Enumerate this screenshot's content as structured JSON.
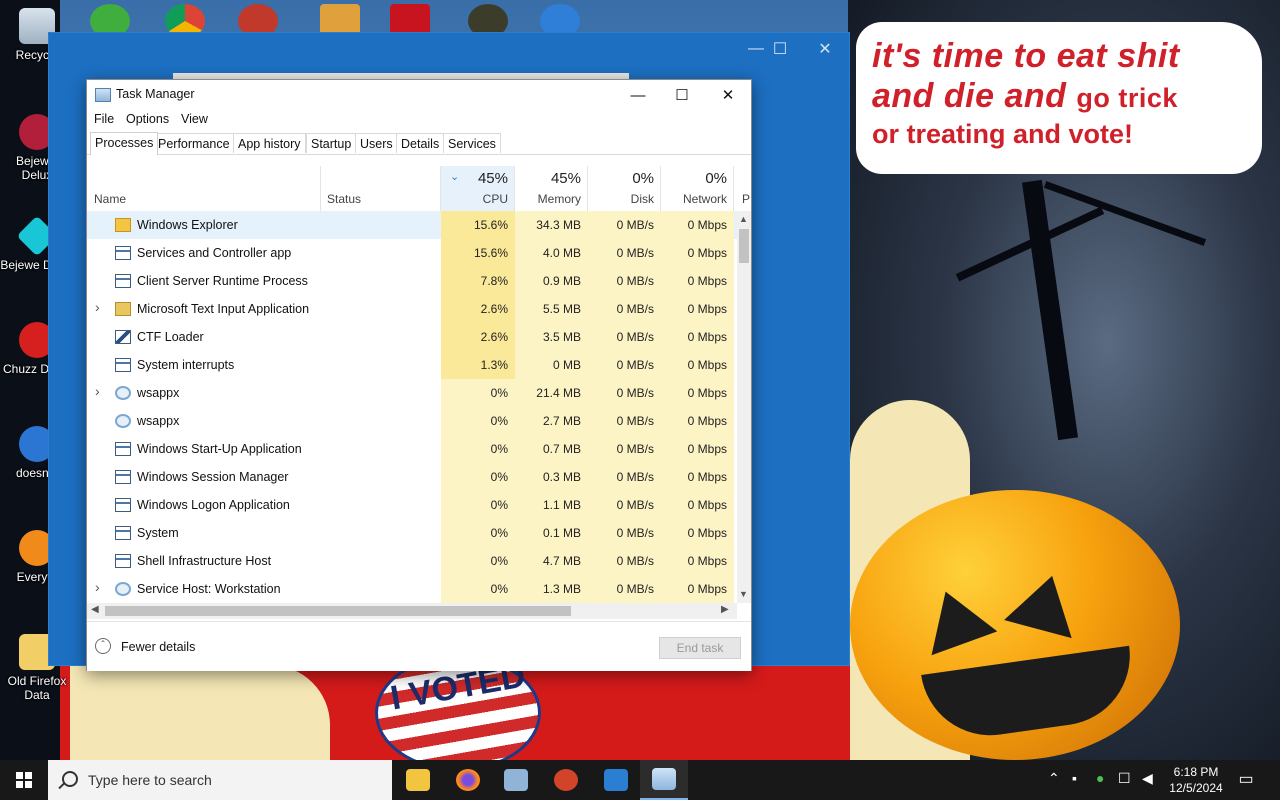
{
  "desktop": {
    "speech_bubble": {
      "line1": "it's time to eat shit",
      "line2a": "and die and",
      "line2b": "go trick",
      "line3": "or treating and vote!"
    },
    "badge_text": "I VOTED",
    "icons": [
      {
        "name": "recycle-bin",
        "label": "Recycle"
      },
      {
        "name": "bejeweled-1",
        "label": "Bejewel Delux"
      },
      {
        "name": "bejeweled-2",
        "label": "Bejewe Delux"
      },
      {
        "name": "chuzzle",
        "label": "Chuzz Delux"
      },
      {
        "name": "doesnt",
        "label": "doesnt l"
      },
      {
        "name": "everything",
        "label": "Everyth"
      },
      {
        "name": "old-firefox-data",
        "label": "Old Firefox Data"
      }
    ]
  },
  "task_manager": {
    "title": "Task Manager",
    "menu": [
      "File",
      "Options",
      "View"
    ],
    "tabs": [
      "Processes",
      "Performance",
      "App history",
      "Startup",
      "Users",
      "Details",
      "Services"
    ],
    "active_tab": "Processes",
    "columns": {
      "name": "Name",
      "status": "Status",
      "cpu": {
        "pct": "45%",
        "label": "CPU"
      },
      "memory": {
        "pct": "45%",
        "label": "Memory"
      },
      "disk": {
        "pct": "0%",
        "label": "Disk"
      },
      "network": {
        "pct": "0%",
        "label": "Network"
      },
      "power": "P"
    },
    "processes": [
      {
        "name": "Windows Explorer",
        "icon": "folder-icon",
        "expand": false,
        "cpu": "15.6%",
        "memory": "34.3 MB",
        "disk": "0 MB/s",
        "network": "0 Mbps"
      },
      {
        "name": "Services and Controller app",
        "icon": "window-icon",
        "expand": false,
        "cpu": "15.6%",
        "memory": "4.0 MB",
        "disk": "0 MB/s",
        "network": "0 Mbps"
      },
      {
        "name": "Client Server Runtime Process",
        "icon": "window-icon",
        "expand": false,
        "cpu": "7.8%",
        "memory": "0.9 MB",
        "disk": "0 MB/s",
        "network": "0 Mbps"
      },
      {
        "name": "Microsoft Text Input Application",
        "icon": "keyboard-icon",
        "expand": true,
        "cpu": "2.6%",
        "memory": "5.5 MB",
        "disk": "0 MB/s",
        "network": "0 Mbps"
      },
      {
        "name": "CTF Loader",
        "icon": "pen-icon",
        "expand": false,
        "cpu": "2.6%",
        "memory": "3.5 MB",
        "disk": "0 MB/s",
        "network": "0 Mbps"
      },
      {
        "name": "System interrupts",
        "icon": "window-icon",
        "expand": false,
        "cpu": "1.3%",
        "memory": "0 MB",
        "disk": "0 MB/s",
        "network": "0 Mbps"
      },
      {
        "name": "wsappx",
        "icon": "gear-icon",
        "expand": true,
        "cpu": "0%",
        "memory": "21.4 MB",
        "disk": "0 MB/s",
        "network": "0 Mbps"
      },
      {
        "name": "wsappx",
        "icon": "gear-icon",
        "expand": false,
        "cpu": "0%",
        "memory": "2.7 MB",
        "disk": "0 MB/s",
        "network": "0 Mbps"
      },
      {
        "name": "Windows Start-Up Application",
        "icon": "window-icon",
        "expand": false,
        "cpu": "0%",
        "memory": "0.7 MB",
        "disk": "0 MB/s",
        "network": "0 Mbps"
      },
      {
        "name": "Windows Session Manager",
        "icon": "window-icon",
        "expand": false,
        "cpu": "0%",
        "memory": "0.3 MB",
        "disk": "0 MB/s",
        "network": "0 Mbps"
      },
      {
        "name": "Windows Logon Application",
        "icon": "window-icon",
        "expand": false,
        "cpu": "0%",
        "memory": "1.1 MB",
        "disk": "0 MB/s",
        "network": "0 Mbps"
      },
      {
        "name": "System",
        "icon": "window-icon",
        "expand": false,
        "cpu": "0%",
        "memory": "0.1 MB",
        "disk": "0 MB/s",
        "network": "0 Mbps"
      },
      {
        "name": "Shell Infrastructure Host",
        "icon": "window-icon",
        "expand": false,
        "cpu": "0%",
        "memory": "4.7 MB",
        "disk": "0 MB/s",
        "network": "0 Mbps"
      },
      {
        "name": "Service Host: Workstation",
        "icon": "gear-icon",
        "expand": true,
        "cpu": "0%",
        "memory": "1.3 MB",
        "disk": "0 MB/s",
        "network": "0 Mbps"
      }
    ],
    "footer": {
      "fewer_details": "Fewer details",
      "end_task": "End task"
    }
  },
  "taskbar": {
    "search_placeholder": "Type here to search",
    "time": "6:18 PM",
    "date": "12/5/2024"
  },
  "colors": {
    "cpu_high": "#fbe99a",
    "cpu_low": "#fdf4c6",
    "accent": "#3a7cc8",
    "taskbar": "#181818"
  }
}
